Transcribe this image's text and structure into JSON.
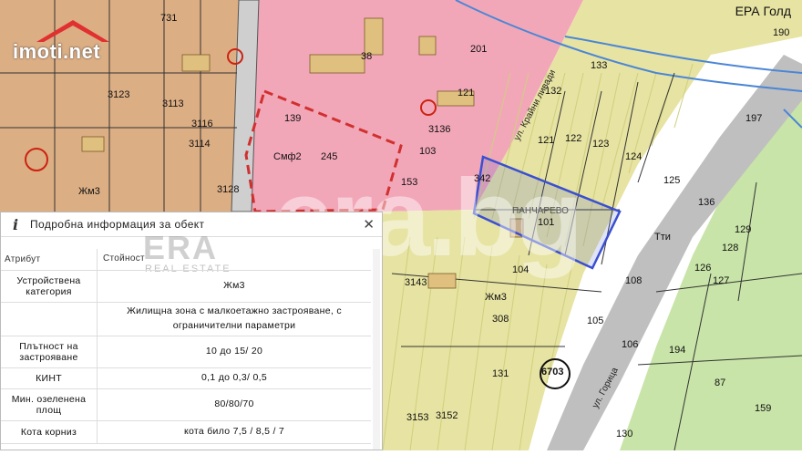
{
  "brand_badge": "ЕРА Голд",
  "logo_text": "imoti.net",
  "watermark": "era.bg",
  "parcels": {
    "p731": "731",
    "p3123": "3123",
    "p3113": "3113",
    "p3116": "3116",
    "p3114": "3114",
    "p3136": "3136",
    "p3128": "3128",
    "p245": "245",
    "p139": "139",
    "p38": "38",
    "p201": "201",
    "p133": "133",
    "p132": "132",
    "p121": "121",
    "p122": "122",
    "p123": "123",
    "p124": "124",
    "p125": "125",
    "p136": "136",
    "p129": "129",
    "p128": "128",
    "p126": "126",
    "p127": "127",
    "p101": "101",
    "p104": "104",
    "p108": "108",
    "p105": "105",
    "p106": "106",
    "p308": "308",
    "p131": "131",
    "p194": "194",
    "p87": "87",
    "p159": "159",
    "p130": "130",
    "p3143": "3143",
    "p3153": "3153",
    "p3152": "3152",
    "p190": "190",
    "p197": "197",
    "p342": "342",
    "p103": "103",
    "p153": "153",
    "p6703": "6703",
    "z_smf2": "Смф2",
    "z_zhm3": "Жм3",
    "z_zhm3b": "Жм3",
    "z_tti": "Тти",
    "street_krayni": "ул. Крайни ливади",
    "street_goritsa": "ул. Горица",
    "street_pancharevo": "ПАНЧАРЕВО"
  },
  "panel": {
    "title": "Подробна информация за обект",
    "col_attr": "Атрибут",
    "col_val": "Стойност",
    "overlay_brand": "ERA",
    "overlay_sub": "REAL ESTATE",
    "rows": [
      {
        "attr": "Устройствена категория",
        "val": "Жм3"
      },
      {
        "attr": "",
        "val": "Жилищна зона с малкоетажно застрояване, с ограничителни параметри"
      },
      {
        "attr": "Плътност на застрояване",
        "val": "10 до 15/ 20"
      },
      {
        "attr": "КИНТ",
        "val": "0,1 до 0,3/ 0,5"
      },
      {
        "attr": "Мин. озеленена площ",
        "val": "80/80/70"
      },
      {
        "attr": "Кота корниз",
        "val": "кота било 7,5 / 8,5 / 7"
      }
    ]
  },
  "colors": {
    "residential_pink": "#f4a6b8",
    "residential_brown": "#e2b48c",
    "yellow_zone": "#e9e4a1",
    "green_zone": "#c9e5a6",
    "road_gray": "#b9b9b9",
    "selected_blue": "#3a4fd0"
  }
}
